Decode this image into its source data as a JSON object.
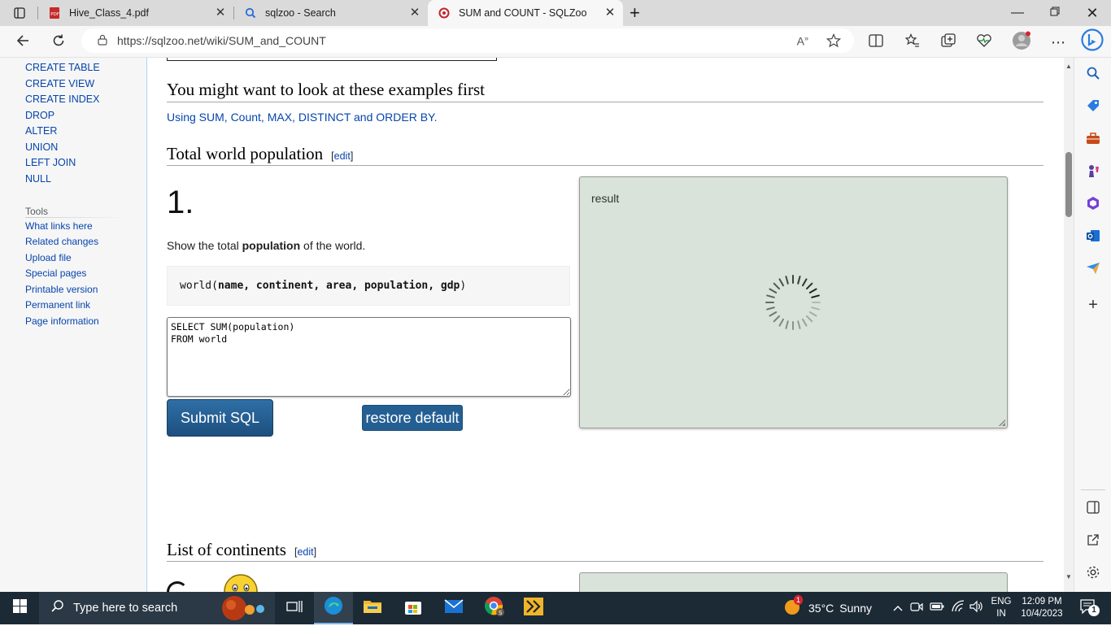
{
  "browser": {
    "tabs": [
      {
        "title": "Hive_Class_4.pdf",
        "icon": "pdf-icon"
      },
      {
        "title": "sqlzoo - Search",
        "icon": "search-icon"
      },
      {
        "title": "SUM and COUNT - SQLZoo",
        "icon": "sqlzoo-icon"
      }
    ],
    "url": "https://sqlzoo.net/wiki/SUM_and_COUNT"
  },
  "leftnav": {
    "links": [
      "CREATE TABLE",
      "CREATE VIEW",
      "CREATE INDEX",
      "DROP",
      "ALTER",
      "UNION",
      "LEFT JOIN",
      "NULL"
    ],
    "tools_title": "Tools",
    "tools": [
      "What links here",
      "Related changes",
      "Upload file",
      "Special pages",
      "Printable version",
      "Permanent link",
      "Page information"
    ]
  },
  "content": {
    "examples_heading": "You might want to look at these examples first",
    "examples_link": "Using SUM, Count, MAX, DISTINCT and ORDER BY.",
    "section1_heading": "Total world population",
    "edit_label": "edit",
    "q_number": "1.",
    "q_text_pre": "Show the total ",
    "q_text_bold": "population",
    "q_text_post": " of the world.",
    "schema_fn": "world(",
    "schema_cols": "name, continent, area, population, gdp",
    "schema_end": ")",
    "sql_text": "SELECT SUM(population)\nFROM world",
    "submit_label": "Submit SQL",
    "restore_label": "restore default",
    "result_label": "result",
    "section2_heading": "List of continents"
  },
  "taskbar": {
    "search_placeholder": "Type here to search",
    "weather_temp": "35°C",
    "weather_text": "Sunny",
    "lang1": "ENG",
    "lang2": "IN",
    "time": "12:09 PM",
    "date": "10/4/2023",
    "notif_count": "1",
    "weather_badge": "1"
  }
}
